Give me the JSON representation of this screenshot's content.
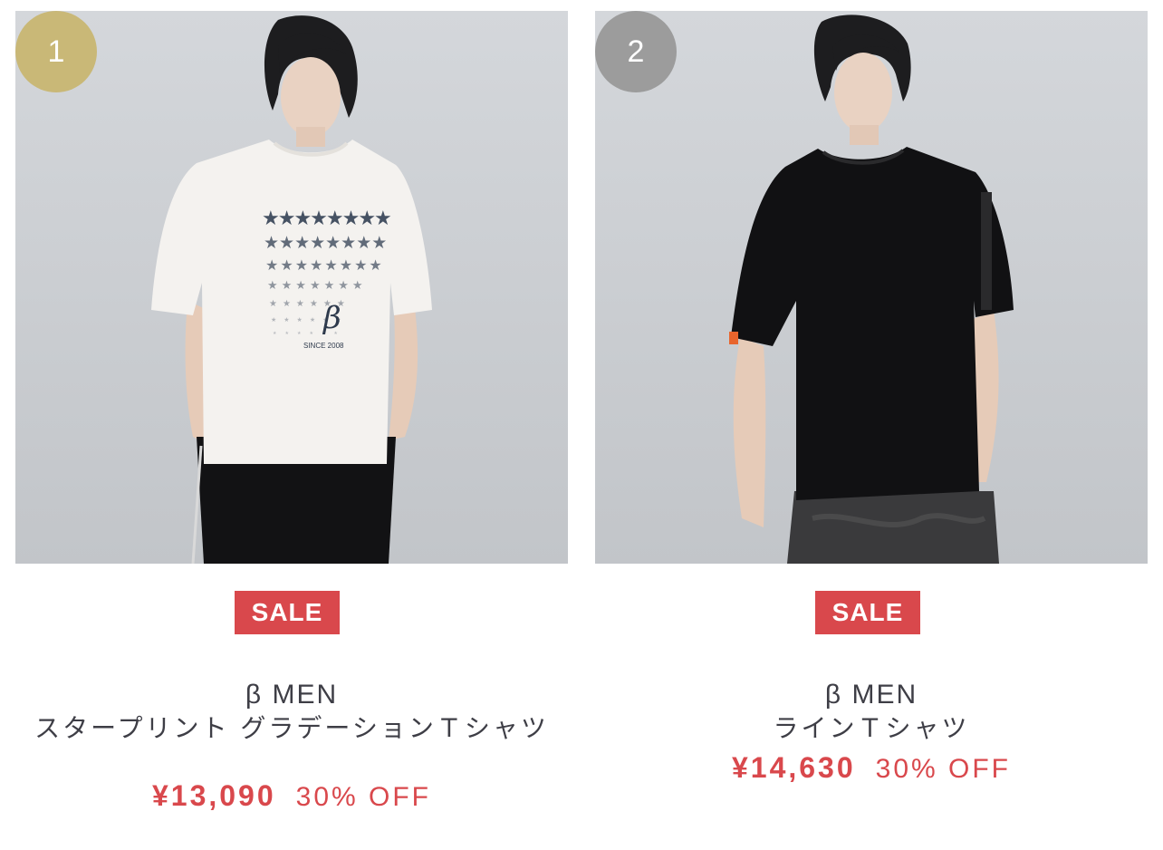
{
  "products": [
    {
      "rank": "1",
      "sale_label": "SALE",
      "brand": "β MEN",
      "name": "スタープリント グラデーションＴシャツ",
      "price": "¥13,090",
      "discount": "30% OFF",
      "shirt_color": "white",
      "print_text": "SINCE 2008",
      "colors": {
        "rank_badge": "#c9b877",
        "sale": "#d9484c"
      }
    },
    {
      "rank": "2",
      "sale_label": "SALE",
      "brand": "β MEN",
      "name": "ラインＴシャツ",
      "price": "¥14,630",
      "discount": "30% OFF",
      "shirt_color": "black",
      "colors": {
        "rank_badge": "#9c9c9c",
        "sale": "#d9484c"
      }
    }
  ]
}
